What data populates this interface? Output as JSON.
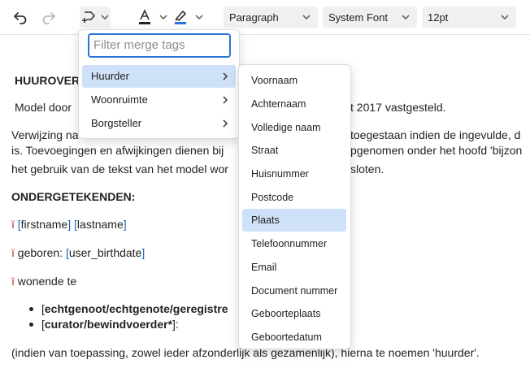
{
  "toolbar": {
    "block_format": "Paragraph",
    "font_family": "System Font",
    "font_size": "12pt",
    "text_color": "#222222",
    "highlight_color": "#2a74d8"
  },
  "document": {
    "heading": "HUUROVER",
    "intro_left": "Model door",
    "intro_right": "t 2017 vastgesteld.",
    "ref_line1_left": "Verwijzing na",
    "ref_line1_right": "toegestaan indien de ingevulde, d",
    "ref_line2_left": "is. Toevoegingen en afwijkingen dienen bij",
    "ref_line2_right": "pgenomen onder het hoofd 'bijzon",
    "ref_line3_left": "het gebruik van de tekst van het model wor",
    "ref_line3_right": "sloten.",
    "signers_heading": "ONDERGETEKENDEN:",
    "line_names": {
      "mark": "ï",
      "open1": "[",
      "firstname": "firstname",
      "close1": "]",
      "open2": "[",
      "lastname": "lastname",
      "close2": "]"
    },
    "line_birth": {
      "mark": "ï",
      "label": "geboren:",
      "open": "[",
      "tag": "user_birthdate",
      "close": "]"
    },
    "line_living": {
      "mark": "ï",
      "label": "wonende te"
    },
    "bullets": [
      {
        "open": "[",
        "text": "echtgenoot/echtgenote/geregistre",
        "close": ""
      },
      {
        "open": "[",
        "text": "curator/bewindvoerder*",
        "close": "]:"
      }
    ],
    "closing": "(indien van toepassing, zowel ieder afzonderlijk als gezamenlijk), hierna te noemen 'huurder'."
  },
  "merge_menu": {
    "filter_placeholder": "Filter merge tags",
    "categories": [
      {
        "label": "Huurder",
        "active": true
      },
      {
        "label": "Woonruimte",
        "active": false
      },
      {
        "label": "Borgsteller",
        "active": false
      }
    ],
    "submenu": [
      {
        "label": "Voornaam",
        "active": false
      },
      {
        "label": "Achternaam",
        "active": false
      },
      {
        "label": "Volledige naam",
        "active": false
      },
      {
        "label": "Straat",
        "active": false
      },
      {
        "label": "Huisnummer",
        "active": false
      },
      {
        "label": "Postcode",
        "active": false
      },
      {
        "label": "Plaats",
        "active": true
      },
      {
        "label": "Telefoonnummer",
        "active": false
      },
      {
        "label": "Email",
        "active": false
      },
      {
        "label": "Document nummer",
        "active": false
      },
      {
        "label": "Geboorteplaats",
        "active": false
      },
      {
        "label": "Geboortedatum",
        "active": false
      }
    ]
  }
}
